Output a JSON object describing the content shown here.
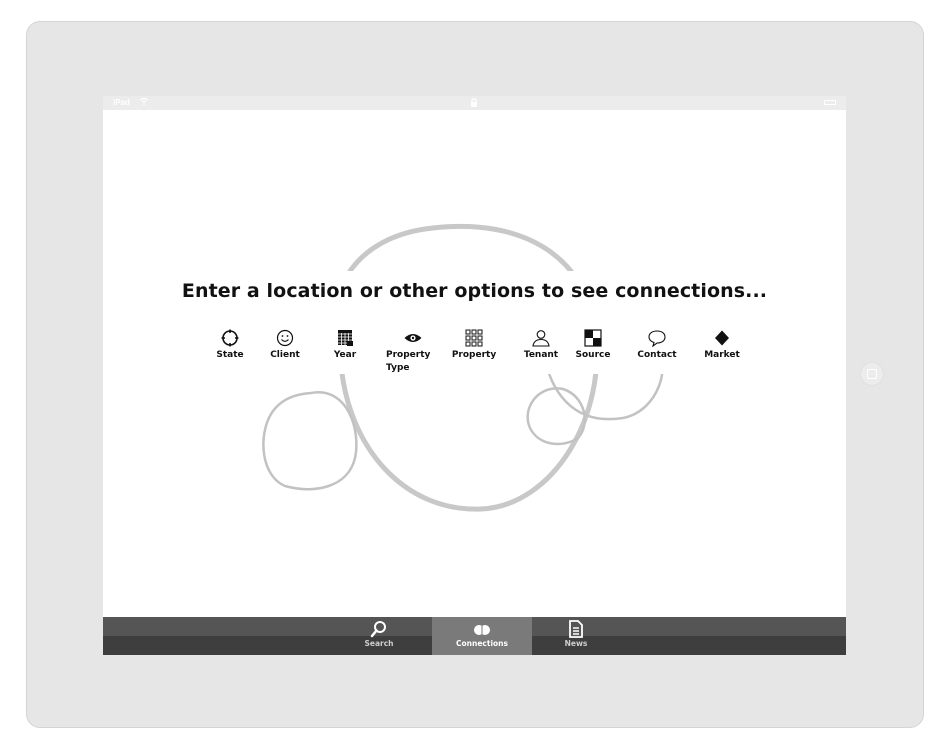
{
  "status_bar": {
    "carrier": "iPad",
    "wifi_icon": "wifi-icon",
    "lock_icon": "lock-icon",
    "battery_icon": "battery-icon"
  },
  "headline": "Enter a location or other options to see connections...",
  "options": [
    {
      "label": "State",
      "icon": "crosshair-circle-icon"
    },
    {
      "label": "Client",
      "icon": "smiley-icon"
    },
    {
      "label": "Year",
      "icon": "calendar-icon"
    },
    {
      "label": "Property Type",
      "icon": "eye-icon"
    },
    {
      "label": "Property",
      "icon": "grid-icon"
    },
    {
      "label": "Tenant",
      "icon": "person-icon"
    },
    {
      "label": "Source",
      "icon": "checkerboard-icon"
    },
    {
      "label": "Contact",
      "icon": "speech-bubble-icon"
    },
    {
      "label": "Market",
      "icon": "diamond-icon"
    }
  ],
  "tabs": [
    {
      "label": "Search",
      "icon": "magnifier-icon",
      "active": false
    },
    {
      "label": "Connections",
      "icon": "connections-icon",
      "active": true
    },
    {
      "label": "News",
      "icon": "document-icon",
      "active": false
    }
  ],
  "colors": {
    "device_frame": "#e6e6e6",
    "tabbar": "#4a4a4a",
    "active_tab": "#7a7a7a",
    "sketch_stroke": "#c8c8c8"
  }
}
